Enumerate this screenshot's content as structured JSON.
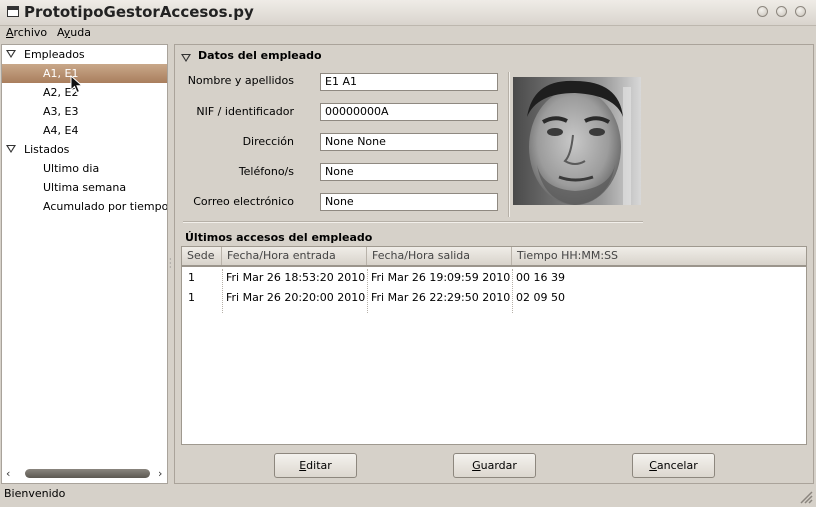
{
  "window": {
    "title": "PrototipoGestorAccesos.py"
  },
  "menu": [
    {
      "mnemonic": "A",
      "rest": "rchivo"
    },
    {
      "mnemonic": "y",
      "pre": "A",
      "rest": "uda"
    }
  ],
  "tree": {
    "groups": [
      {
        "label": "Empleados",
        "items": [
          "A1, E1",
          "A2, E2",
          "A3, E3",
          "A4, E4"
        ],
        "selected_index": 0
      },
      {
        "label": "Listados",
        "items": [
          "Ultimo dia",
          "Ultima semana",
          "Acumulado por tiempo"
        ]
      }
    ],
    "scroll_left": "‹",
    "scroll_right": "›"
  },
  "employee": {
    "section_title": "Datos del empleado",
    "fields": [
      {
        "label": "Nombre y apellidos",
        "value": "E1 A1"
      },
      {
        "label": "NIF / identificador",
        "value": "00000000A"
      },
      {
        "label": "Dirección",
        "value": "None None"
      },
      {
        "label": "Teléfono/s",
        "value": "None"
      },
      {
        "label": "Correo electrónico",
        "value": "None"
      }
    ]
  },
  "access": {
    "section_title": "Últimos accesos del empleado",
    "columns": [
      "Sede",
      "Fecha/Hora entrada",
      "Fecha/Hora salida",
      "Tiempo HH:MM:SS"
    ],
    "rows": [
      [
        "1",
        "Fri Mar 26 18:53:20 2010",
        "Fri Mar 26 19:09:59 2010",
        "00 16 39"
      ],
      [
        "1",
        "Fri Mar 26 20:20:00 2010",
        "Fri Mar 26 22:29:50 2010",
        "02 09 50"
      ]
    ]
  },
  "buttons": {
    "edit": {
      "mnemonic": "E",
      "rest": "ditar"
    },
    "save": {
      "mnemonic": "G",
      "rest": "uardar"
    },
    "cancel": {
      "mnemonic": "C",
      "rest": "ancelar"
    }
  },
  "status": {
    "text": "Bienvenido"
  }
}
